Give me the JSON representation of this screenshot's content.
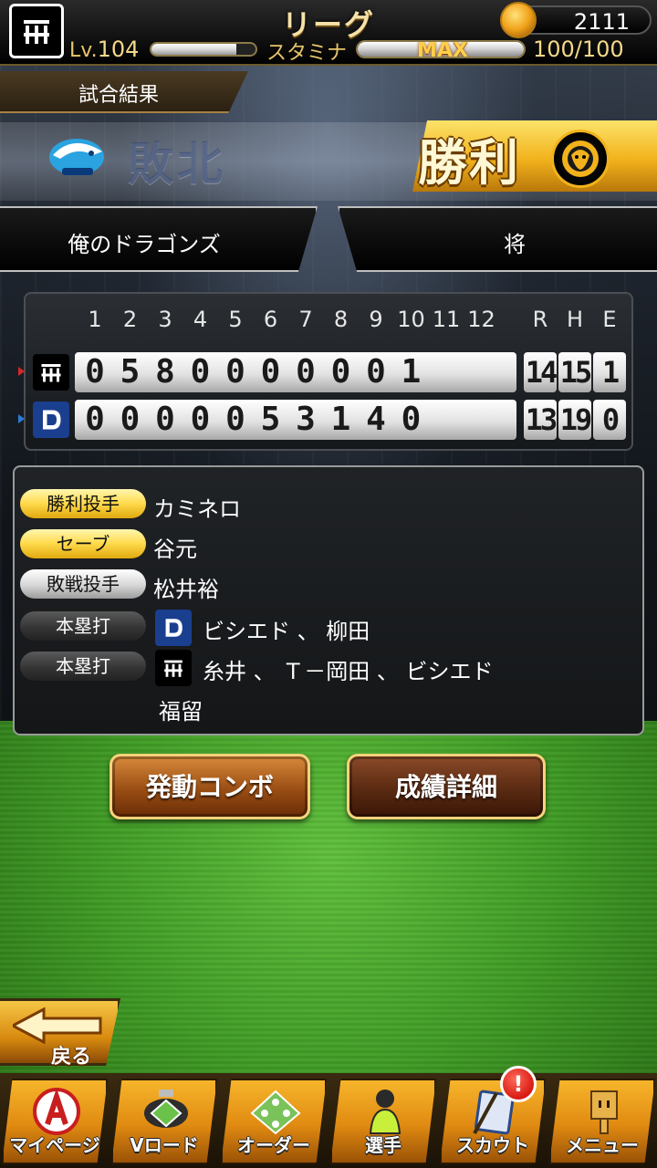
{
  "header": {
    "title": "リーグ",
    "coins": "2111",
    "level_prefix": "Lv.",
    "level": "104",
    "stamina_label": "スタミナ",
    "stamina_max_label": "MAX",
    "stamina_value": "100/100",
    "exp_fraction": 0.82,
    "stamina_fraction": 1.0
  },
  "result": {
    "tab_label": "試合結果",
    "away_result": "敗北",
    "home_result": "勝利",
    "away_team_name": "俺のドラゴンズ",
    "home_team_name": "将"
  },
  "scoreboard": {
    "innings": [
      "1",
      "2",
      "3",
      "4",
      "5",
      "6",
      "7",
      "8",
      "9",
      "10",
      "11",
      "12"
    ],
    "rhe_headers": [
      "R",
      "H",
      "E"
    ],
    "rows": [
      {
        "team": "tigers",
        "innings": [
          "0",
          "5",
          "8",
          "0",
          "0",
          "0",
          "0",
          "0",
          "0",
          "1"
        ],
        "R": "14",
        "H": "15",
        "E": "1"
      },
      {
        "team": "dragons",
        "innings": [
          "0",
          "0",
          "0",
          "0",
          "0",
          "5",
          "3",
          "1",
          "4",
          "0"
        ],
        "R": "13",
        "H": "19",
        "E": "0"
      }
    ]
  },
  "pitching": {
    "win_label": "勝利投手",
    "win_value": "カミネロ",
    "save_label": "セーブ",
    "save_value": "谷元",
    "loss_label": "敗戦投手",
    "loss_value": "松井裕",
    "hr_label": "本塁打",
    "hr_dragons": "ビシエド 、 柳田",
    "hr_tigers": "糸井 、 Ｔ－岡田 、 ビシエド",
    "hr_tigers_cont": "福留"
  },
  "buttons": {
    "combo": "発動コンボ",
    "stats": "成績詳細",
    "back": "戻る"
  },
  "nav": {
    "items": [
      "マイページ",
      "Vロード",
      "オーダー",
      "選手",
      "スカウト",
      "メニュー"
    ],
    "notice_badge": "!"
  },
  "colors": {
    "gold": "#f2b21c",
    "dragons_blue": "#1b3f8f",
    "tigers_black": "#000000",
    "field_green": "#3f9a24"
  }
}
